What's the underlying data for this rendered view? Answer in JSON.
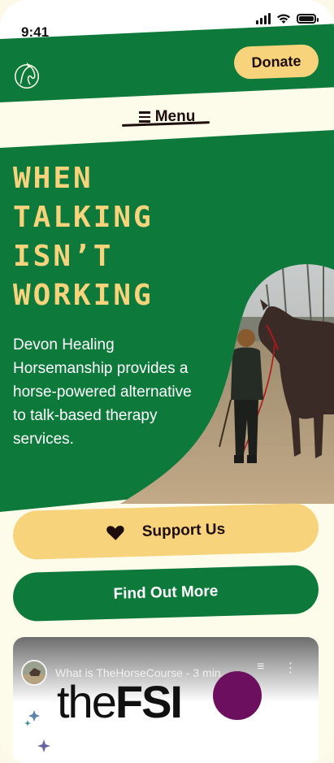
{
  "status": {
    "time": "9:41"
  },
  "header": {
    "logo_icon": "horse-head-logo-icon",
    "donate_label": "Donate"
  },
  "menu": {
    "label": "Menu",
    "icon": "hamburger-icon"
  },
  "hero": {
    "headline_lines": [
      "WHEN",
      "TALKING",
      "ISN’T",
      "WORKING"
    ],
    "description": "Devon Healing Horsemanship provides a horse-powered alternative to talk-based therapy services.",
    "photo": "person-walking-horse-photo"
  },
  "actions": {
    "support_label": "Support Us",
    "support_icon": "heart-icon",
    "findout_label": "Find Out More"
  },
  "video": {
    "title": "What is TheHorseCourse - 3 min...",
    "brand_light": "the",
    "brand_bold": "FSI"
  },
  "colors": {
    "green": "#0d7a3b",
    "yellow": "#f7d37c",
    "cream": "#fdfbea",
    "dark": "#1d0d0c",
    "purple": "#6b0f5e"
  }
}
